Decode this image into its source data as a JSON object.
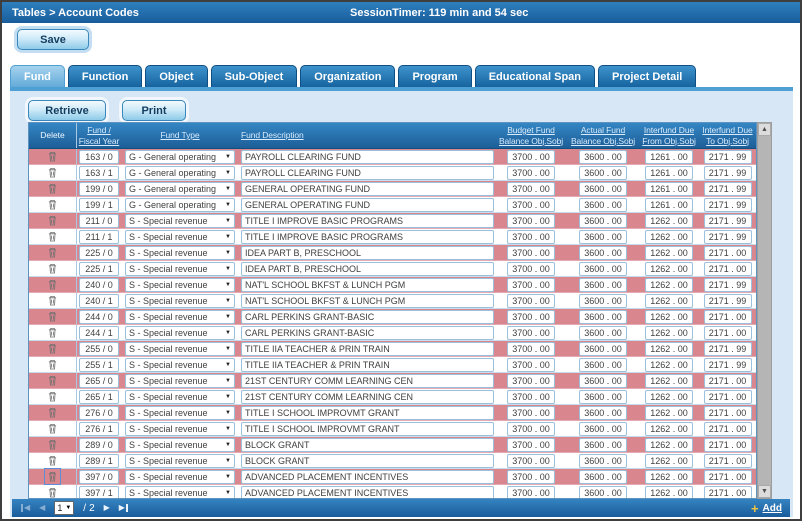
{
  "header": {
    "breadcrumb": "Tables > Account Codes",
    "session_timer": "SessionTimer: 119 min and 54 sec"
  },
  "toolbar": {
    "save_label": "Save",
    "retrieve_label": "Retrieve",
    "print_label": "Print"
  },
  "tabs": {
    "active": "Fund",
    "items": [
      "Fund",
      "Function",
      "Object",
      "Sub-Object",
      "Organization",
      "Program",
      "Educational Span",
      "Project Detail"
    ]
  },
  "table": {
    "columns": [
      {
        "id": "delete",
        "label": "Delete",
        "sortable": false
      },
      {
        "id": "fund",
        "label": "Fund /\nFiscal Year",
        "sortable": true
      },
      {
        "id": "type",
        "label": "Fund Type",
        "sortable": true
      },
      {
        "id": "description",
        "label": "Fund Description",
        "sortable": true
      },
      {
        "id": "budget",
        "label": "Budget Fund\nBalance Obj.Sobj",
        "sortable": true
      },
      {
        "id": "actual",
        "label": "Actual Fund\nBalance Obj.Sobj",
        "sortable": true
      },
      {
        "id": "due_from",
        "label": "Interfund Due\nFrom Obj.Sobj",
        "sortable": true
      },
      {
        "id": "due_to",
        "label": "Interfund Due\nTo Obj.Sobj",
        "sortable": true
      }
    ],
    "rows": [
      {
        "fund": "163 / 0",
        "type": "G - General operating",
        "description": "PAYROLL CLEARING FUND",
        "budget": "3700 . 00",
        "actual": "3600 . 00",
        "due_from": "1261 . 00",
        "due_to": "2171 . 99"
      },
      {
        "fund": "163 / 1",
        "type": "G - General operating",
        "description": "PAYROLL CLEARING FUND",
        "budget": "3700 . 00",
        "actual": "3600 . 00",
        "due_from": "1261 . 00",
        "due_to": "2171 . 99"
      },
      {
        "fund": "199 / 0",
        "type": "G - General operating",
        "description": "GENERAL OPERATING FUND",
        "budget": "3700 . 00",
        "actual": "3600 . 00",
        "due_from": "1261 . 00",
        "due_to": "2171 . 99"
      },
      {
        "fund": "199 / 1",
        "type": "G - General operating",
        "description": "GENERAL OPERATING FUND",
        "budget": "3700 . 00",
        "actual": "3600 . 00",
        "due_from": "1261 . 00",
        "due_to": "2171 . 99"
      },
      {
        "fund": "211 / 0",
        "type": "S - Special revenue",
        "description": "TITLE I IMPROVE BASIC PROGRAMS",
        "budget": "3700 . 00",
        "actual": "3600 . 00",
        "due_from": "1262 . 00",
        "due_to": "2171 . 99"
      },
      {
        "fund": "211 / 1",
        "type": "S - Special revenue",
        "description": "TITLE I IMPROVE BASIC PROGRAMS",
        "budget": "3700 . 00",
        "actual": "3600 . 00",
        "due_from": "1262 . 00",
        "due_to": "2171 . 99"
      },
      {
        "fund": "225 / 0",
        "type": "S - Special revenue",
        "description": "IDEA PART B, PRESCHOOL",
        "budget": "3700 . 00",
        "actual": "3600 . 00",
        "due_from": "1262 . 00",
        "due_to": "2171 . 00"
      },
      {
        "fund": "225 / 1",
        "type": "S - Special revenue",
        "description": "IDEA PART B, PRESCHOOL",
        "budget": "3700 . 00",
        "actual": "3600 . 00",
        "due_from": "1262 . 00",
        "due_to": "2171 . 00"
      },
      {
        "fund": "240 / 0",
        "type": "S - Special revenue",
        "description": "NAT'L SCHOOL BKFST & LUNCH PGM",
        "budget": "3700 . 00",
        "actual": "3600 . 00",
        "due_from": "1262 . 00",
        "due_to": "2171 . 99"
      },
      {
        "fund": "240 / 1",
        "type": "S - Special revenue",
        "description": "NAT'L SCHOOL BKFST & LUNCH PGM",
        "budget": "3700 . 00",
        "actual": "3600 . 00",
        "due_from": "1262 . 00",
        "due_to": "2171 . 99"
      },
      {
        "fund": "244 / 0",
        "type": "S - Special revenue",
        "description": "CARL PERKINS GRANT-BASIC",
        "budget": "3700 . 00",
        "actual": "3600 . 00",
        "due_from": "1262 . 00",
        "due_to": "2171 . 00"
      },
      {
        "fund": "244 / 1",
        "type": "S - Special revenue",
        "description": "CARL PERKINS GRANT-BASIC",
        "budget": "3700 . 00",
        "actual": "3600 . 00",
        "due_from": "1262 . 00",
        "due_to": "2171 . 00"
      },
      {
        "fund": "255 / 0",
        "type": "S - Special revenue",
        "description": "TITLE IIA TEACHER & PRIN TRAIN",
        "budget": "3700 . 00",
        "actual": "3600 . 00",
        "due_from": "1262 . 00",
        "due_to": "2171 . 99"
      },
      {
        "fund": "255 / 1",
        "type": "S - Special revenue",
        "description": "TITLE IIA TEACHER & PRIN TRAIN",
        "budget": "3700 . 00",
        "actual": "3600 . 00",
        "due_from": "1262 . 00",
        "due_to": "2171 . 99"
      },
      {
        "fund": "265 / 0",
        "type": "S - Special revenue",
        "description": "21ST CENTURY COMM LEARNING CEN",
        "budget": "3700 . 00",
        "actual": "3600 . 00",
        "due_from": "1262 . 00",
        "due_to": "2171 . 00"
      },
      {
        "fund": "265 / 1",
        "type": "S - Special revenue",
        "description": "21ST CENTURY COMM LEARNING CEN",
        "budget": "3700 . 00",
        "actual": "3600 . 00",
        "due_from": "1262 . 00",
        "due_to": "2171 . 00"
      },
      {
        "fund": "276 / 0",
        "type": "S - Special revenue",
        "description": "TITLE I SCHOOL IMPROVMT GRANT",
        "budget": "3700 . 00",
        "actual": "3600 . 00",
        "due_from": "1262 . 00",
        "due_to": "2171 . 00"
      },
      {
        "fund": "276 / 1",
        "type": "S - Special revenue",
        "description": "TITLE I SCHOOL IMPROVMT GRANT",
        "budget": "3700 . 00",
        "actual": "3600 . 00",
        "due_from": "1262 . 00",
        "due_to": "2171 . 00"
      },
      {
        "fund": "289 / 0",
        "type": "S - Special revenue",
        "description": "BLOCK GRANT",
        "budget": "3700 . 00",
        "actual": "3600 . 00",
        "due_from": "1262 . 00",
        "due_to": "2171 . 00"
      },
      {
        "fund": "289 / 1",
        "type": "S - Special revenue",
        "description": "BLOCK GRANT",
        "budget": "3700 . 00",
        "actual": "3600 . 00",
        "due_from": "1262 . 00",
        "due_to": "2171 . 00"
      },
      {
        "fund": "397 / 0",
        "type": "S - Special revenue",
        "description": "ADVANCED PLACEMENT INCENTIVES",
        "budget": "3700 . 00",
        "actual": "3600 . 00",
        "due_from": "1262 . 00",
        "due_to": "2171 . 00",
        "trash_focused": true
      },
      {
        "fund": "397 / 1",
        "type": "S - Special revenue",
        "description": "ADVANCED PLACEMENT INCENTIVES",
        "budget": "3700 . 00",
        "actual": "3600 . 00",
        "due_from": "1262 . 00",
        "due_to": "2171 . 00"
      }
    ]
  },
  "pagination": {
    "current_page": "1",
    "separator": "/",
    "total_pages": "2",
    "add_plus": "+",
    "add_label": "Add"
  },
  "colors": {
    "topbar_blue": "#1c5e9d",
    "tab_active_blue": "#7db9e2",
    "panel_blue": "#d8e7f5",
    "row_highlight_pink": "#d9868e",
    "header_link_blue": "#d7ebfc",
    "add_plus_gold": "#f3c63f"
  }
}
